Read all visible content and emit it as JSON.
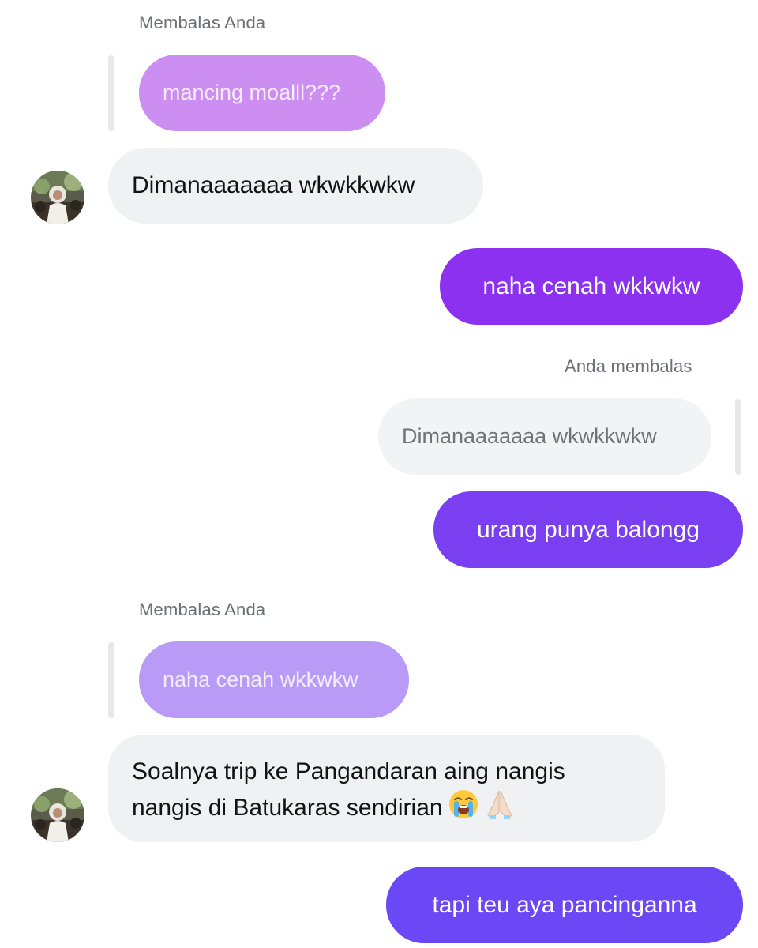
{
  "colors": {
    "quote_purple_1": "#cc8ef0",
    "quote_purple_2": "#b99bf7",
    "outgoing_1": "#8b31ef",
    "outgoing_2": "#7b3ff2",
    "outgoing_3": "#6a48f5",
    "incoming_bg": "#f0f1f3",
    "caption_text": "#6b6f76"
  },
  "messages": {
    "reply_block_1": {
      "caption": "Membalas Anda",
      "quoted_text": "mancing moalll???"
    },
    "incoming_1": {
      "text": "Dimanaaaaaaa wkwkkwkw",
      "avatar_icon": "contact-photo-icon"
    },
    "outgoing_1": {
      "text": "naha cenah wkkwkw"
    },
    "reply_block_2": {
      "caption": "Anda membalas",
      "quoted_text": "Dimanaaaaaaa wkwkkwkw"
    },
    "outgoing_2": {
      "text": "urang punya balongg"
    },
    "reply_block_3": {
      "caption": "Membalas Anda",
      "quoted_text": "naha cenah wkkwkw"
    },
    "incoming_2": {
      "line1": "Soalnya trip ke Pangandaran aing nangis",
      "line2": "nangis di Batukaras sendirian",
      "emoji_1": "loudly-crying-face-icon",
      "emoji_2": "folded-hands-icon",
      "avatar_icon": "contact-photo-icon"
    },
    "outgoing_3": {
      "text": "tapi teu aya pancinganna"
    }
  }
}
